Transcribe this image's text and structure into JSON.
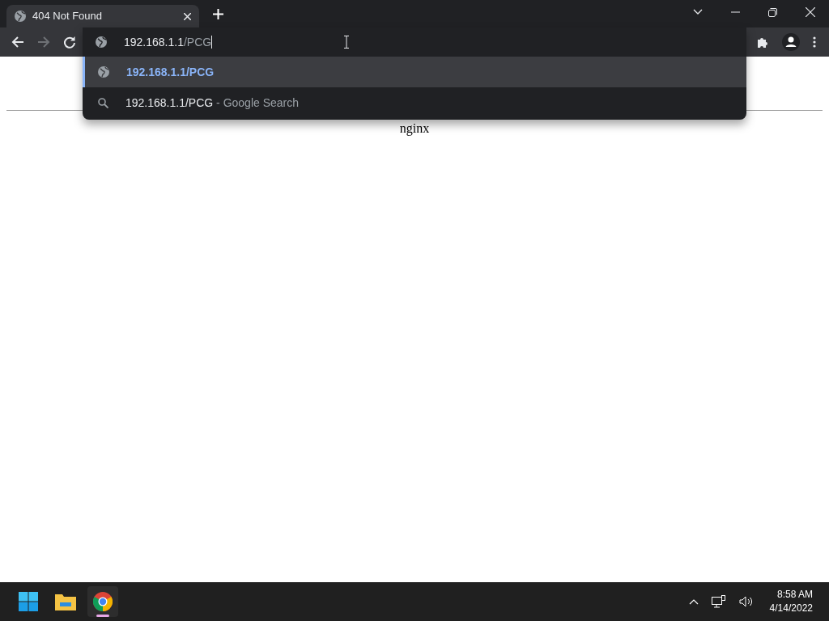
{
  "window": {
    "tabs": [
      {
        "title": "404 Not Found",
        "selected": true
      }
    ]
  },
  "omnibox": {
    "typed": "192.168.1.1",
    "completion": "/PCG"
  },
  "suggestions": [
    {
      "kind": "url",
      "text": "192.168.1.1/PCG",
      "selected": true
    },
    {
      "kind": "search",
      "text": "192.168.1.1/PCG",
      "suffix": " - Google Search",
      "selected": false
    }
  ],
  "page": {
    "footer": "nginx"
  },
  "taskbar": {
    "time": "8:58 AM",
    "date": "4/14/2022"
  }
}
